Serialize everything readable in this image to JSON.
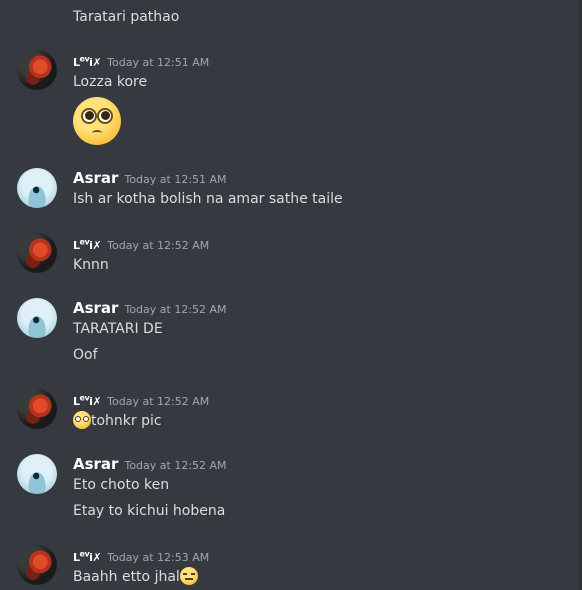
{
  "messages": {
    "continuation_top": "Taratari pathao",
    "groups": [
      {
        "author": "Levi",
        "time": "Today at 12:51 AM",
        "lines": [
          "Lozza kore"
        ],
        "big_emoji": "pleading-face"
      },
      {
        "author": "Asrar",
        "time": "Today at 12:51 AM",
        "lines": [
          "Ish ar kotha bolish na amar sathe taile"
        ]
      },
      {
        "author": "Levi",
        "time": "Today at 12:52 AM",
        "lines": [
          "Knnn"
        ]
      },
      {
        "author": "Asrar",
        "time": "Today at 12:52 AM",
        "lines": [
          "TARATARI DE",
          "Oof"
        ]
      },
      {
        "author": "Levi",
        "time": "Today at 12:52 AM",
        "lines": [
          "tohnkr pic"
        ],
        "inline_emoji": "pleading-face"
      },
      {
        "author": "Asrar",
        "time": "Today at 12:52 AM",
        "lines": [
          "Eto choto ken",
          "Etay to kichui hobena"
        ]
      },
      {
        "author": "Levi",
        "time": "Today at 12:53 AM",
        "lines": [
          "Baahh etto jhal"
        ],
        "inline_emoji": "expressionless-face"
      }
    ]
  },
  "users": {
    "levi": {
      "display_name": "Levi",
      "name_color": "#ffffff"
    },
    "asrar": {
      "display_name": "Asrar",
      "name_color": "#ffffff"
    }
  },
  "theme": {
    "background": "#36393f",
    "text": "#dcddde",
    "timestamp": "#a3a6aa"
  }
}
